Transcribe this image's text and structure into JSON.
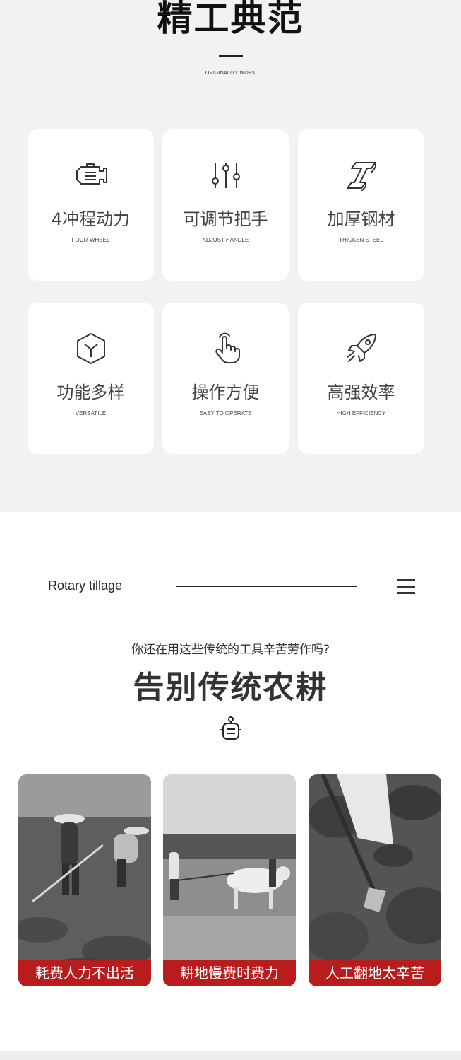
{
  "header": {
    "title": "精工典范",
    "subtitle": "ORIGINALITY WORK"
  },
  "features": [
    {
      "title": "4冲程动力",
      "subtitle": "FOUR-WHEEL",
      "icon": "engine-icon"
    },
    {
      "title": "可调节把手",
      "subtitle": "ADJUST HANDLE",
      "icon": "sliders-icon"
    },
    {
      "title": "加厚钢材",
      "subtitle": "THICKEN STEEL",
      "icon": "steel-beam-icon"
    },
    {
      "title": "功能多样",
      "subtitle": "VERSATILE",
      "icon": "cube-icon"
    },
    {
      "title": "操作方便",
      "subtitle": "EASY TO OPERATE",
      "icon": "hand-pointer-icon"
    },
    {
      "title": "高强效率",
      "subtitle": "HIGH EFFICIENCY",
      "icon": "rocket-icon"
    }
  ],
  "rotary": {
    "label": "Rotary tillage",
    "menu_icon": "menu-icon"
  },
  "intro": {
    "question": "你还在用这些传统的工具辛苦劳作吗?",
    "headline": "告别传统农耕",
    "icon": "robot-icon"
  },
  "photos": [
    {
      "caption": "耗费人力不出活"
    },
    {
      "caption": "耕地慢费时费力"
    },
    {
      "caption": "人工翻地太辛苦"
    }
  ],
  "colors": {
    "background_gray": "#f2f2f2",
    "card_white": "#ffffff",
    "caption_red": "#b81c1c",
    "text_dark": "#333333"
  }
}
